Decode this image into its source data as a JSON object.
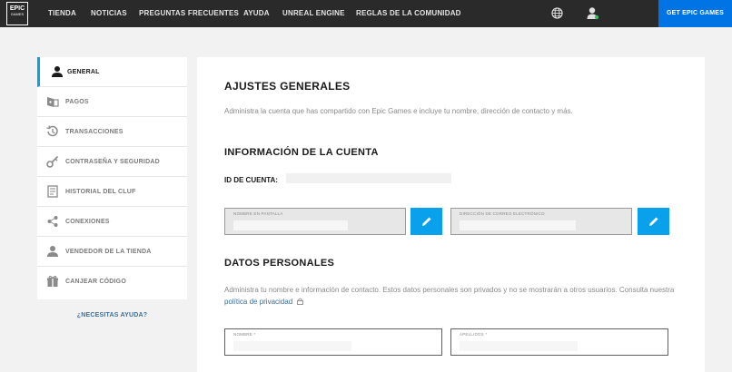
{
  "nav": {
    "logo_line1": "EPIC",
    "logo_line2": "GAMES",
    "links": [
      "TIENDA",
      "NOTICIAS",
      "PREGUNTAS FRECUENTES",
      "AYUDA",
      "UNREAL ENGINE",
      "REGLAS DE LA COMUNIDAD"
    ],
    "cta": "GET EPIC GAMES",
    "icons": [
      "globe-icon",
      "user-icon"
    ]
  },
  "sidebar": {
    "items": [
      {
        "label": "GENERAL",
        "icon": "person-icon",
        "active": true
      },
      {
        "label": "PAGOS",
        "icon": "payments-icon"
      },
      {
        "label": "TRANSACCIONES",
        "icon": "history-icon"
      },
      {
        "label": "CONTRASEÑA Y SEGURIDAD",
        "icon": "key-icon"
      },
      {
        "label": "HISTORIAL DEL CLUF",
        "icon": "document-icon"
      },
      {
        "label": "CONEXIONES",
        "icon": "share-icon"
      },
      {
        "label": "VENDEDOR DE LA TIENDA",
        "icon": "person-icon"
      },
      {
        "label": "CANJEAR CÓDIGO",
        "icon": "gift-icon"
      }
    ],
    "help": "¿NECESITAS AYUDA?"
  },
  "main": {
    "title": "AJUSTES GENERALES",
    "description": "Administra la cuenta que has compartido con Epic Games e incluye tu nombre, dirección de contacto y más.",
    "account": {
      "title": "INFORMACIÓN DE LA CUENTA",
      "id_label": "ID DE CUENTA:",
      "display_name_label": "NOMBRE EN PANTALLA",
      "email_label": "DIRECCIÓN DE CORREO ELECTRÓNICO"
    },
    "personal": {
      "title": "DATOS PERSONALES",
      "description": "Administra tu nombre e información de contacto. Estos datos personales son privados y no se mostrarán a otros usuarios. Consulta nuestra",
      "link": "política de privacidad",
      "first_name_label": "NOMBRE *",
      "last_name_label": "APELLIDOS *"
    }
  },
  "colors": {
    "nav_bg": "#2a2a2a",
    "cta_bg": "#0074e4",
    "accent": "#0aa1ec",
    "link": "#3d6f99"
  }
}
